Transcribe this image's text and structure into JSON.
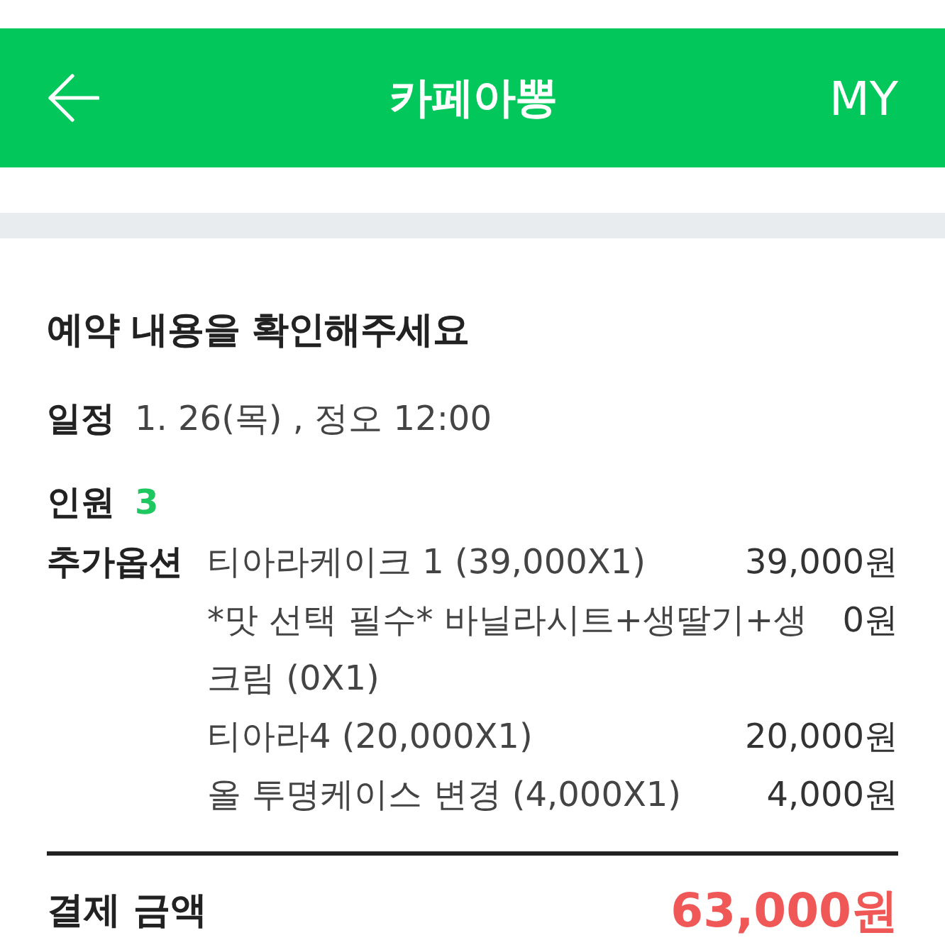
{
  "header": {
    "title": "카페아뽕",
    "right_label": "MY"
  },
  "confirm": {
    "heading": "예약 내용을 확인해주세요",
    "schedule": {
      "label": "일정",
      "value": "1. 26(목) , 정오 12:00"
    },
    "people": {
      "label": "인원",
      "value": "3"
    },
    "options": {
      "label": "추가옵션",
      "items": [
        {
          "name": "티아라케이크 1 (39,000X1)",
          "price": "39,000원"
        },
        {
          "name": "*맛 선택 필수* 바닐라시트+생딸기+생크림 (0X1)",
          "price": "0원"
        },
        {
          "name": "티아라4 (20,000X1)",
          "price": "20,000원"
        },
        {
          "name": "올 투명케이스 변경 (4,000X1)",
          "price": "4,000원"
        }
      ]
    },
    "total": {
      "label": "결제 금액",
      "value": "63,000원"
    }
  }
}
